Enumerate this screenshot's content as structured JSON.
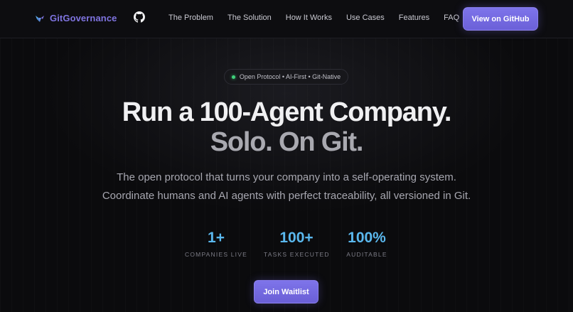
{
  "nav": {
    "brand_name": "GitGovernance",
    "links": [
      "The Problem",
      "The Solution",
      "How It Works",
      "Use Cases",
      "Features",
      "FAQ"
    ],
    "github_button": "View on GitHub"
  },
  "hero": {
    "badge": "Open Protocol • AI-First • Git-Native",
    "headline_line1": "Run a 100-Agent Company.",
    "headline_line2": "Solo. On Git.",
    "subtitle_line1": "The open protocol that turns your company into a self-operating system.",
    "subtitle_line2": "Coordinate humans and AI agents with perfect traceability, all versioned in Git.",
    "stats": [
      {
        "value": "1+",
        "label": "COMPANIES LIVE"
      },
      {
        "value": "100+",
        "label": "TASKS EXECUTED"
      },
      {
        "value": "100%",
        "label": "AUDITABLE"
      }
    ],
    "cta": "Join Waitlist"
  },
  "colors": {
    "brand": "#7f74e0",
    "accent_button": "#7e74ea",
    "stat_value": "#5ab8ee",
    "status_dot": "#3fd07a",
    "background": "#0b0b0d"
  },
  "icons": {
    "brand": "gitgovernance-logo-icon",
    "github": "github-icon",
    "badge_dot": "status-dot-icon"
  }
}
